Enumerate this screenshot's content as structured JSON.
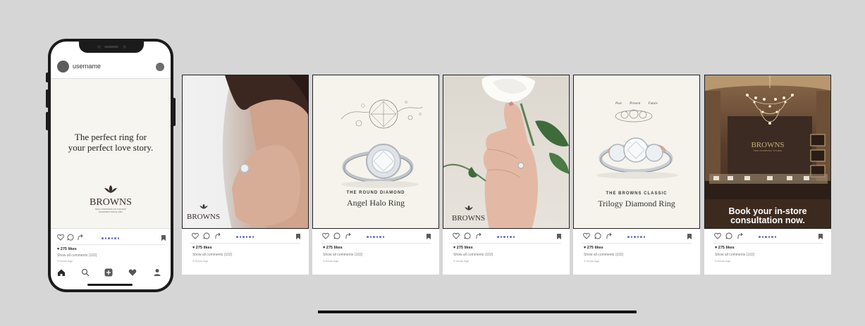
{
  "phone": {
    "username": "username",
    "headline_line1": "The perfect ring for",
    "headline_line2": "your perfect love story.",
    "brand": "BROWNS",
    "brand_tagline1": "REAL DIAMONDS ON THE MAP",
    "brand_tagline2": "DIAMONDS SINCE 1994",
    "likes": "275 likes",
    "comments": "Show all comments (102)",
    "time_ago": "3 Hours Ago"
  },
  "cards": [
    {
      "image": "bride-veil-ring-photo",
      "brand": "BROWNS",
      "likes": "275 likes",
      "comments": "Show all comments (102)",
      "time_ago": "3 Hours Ago"
    },
    {
      "image": "angel-halo-ring",
      "small_caption": "THE ROUND DIAMOND",
      "big_caption": "Angel Halo Ring",
      "likes": "275 likes",
      "comments": "Show all comments (102)",
      "time_ago": "3 Hours Ago"
    },
    {
      "image": "hand-holding-rose-ring",
      "brand": "BROWNS",
      "likes": "275 likes",
      "comments": "Show all comments (102)",
      "time_ago": "3 Hours Ago"
    },
    {
      "image": "trilogy-ring",
      "small_caption": "THE BROWNS CLASSIC",
      "big_caption": "Trilogy Diamond Ring",
      "sketch_labels": [
        "Past",
        "Present",
        "Future"
      ],
      "likes": "275 likes",
      "comments": "Show all comments (102)",
      "time_ago": "3 Hours Ago"
    },
    {
      "image": "store-interior-chandelier",
      "store_sign": "BROWNS",
      "store_sign_sub": "THE DIAMOND STORE",
      "cta_line1": "Book your in-store",
      "cta_line2": "consultation now.",
      "likes": "275 likes",
      "comments": "Show all comments (102)",
      "time_ago": "3 Hours Ago"
    }
  ],
  "colors": {
    "background": "#d6d6d6",
    "carousel_dots": "#6c73c5",
    "post_cream": "#f7f5ef",
    "store_brown": "#4a3426"
  }
}
